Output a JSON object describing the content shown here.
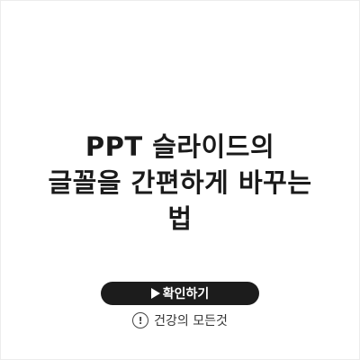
{
  "title": {
    "line1": "PPT 슬라이드의",
    "line2": "글꼴을 간편하게 바꾸는",
    "line3": "법"
  },
  "cta": {
    "icon": "play-triangle-icon",
    "label": "확인하기"
  },
  "brand": {
    "icon": "exclamation-circle-icon",
    "icon_glyph": "!",
    "label": "건강의 모든것"
  }
}
